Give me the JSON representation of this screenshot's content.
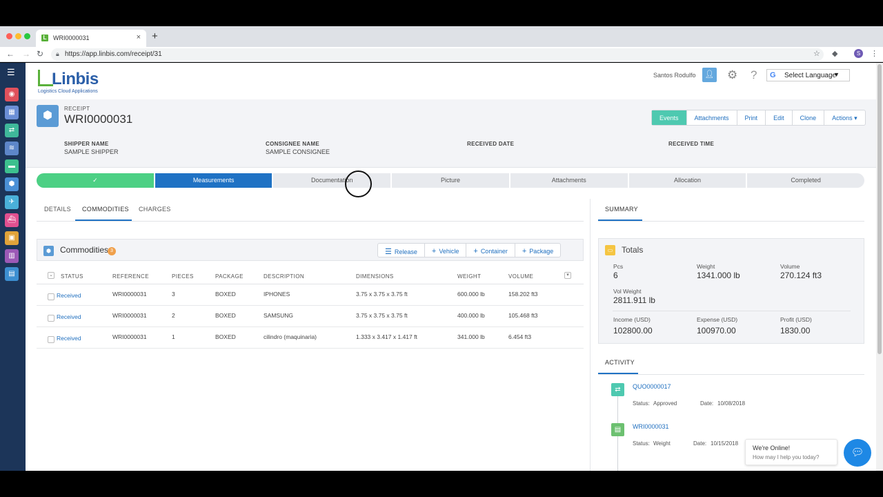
{
  "browser": {
    "tab_title": "WRI0000031",
    "tab_favicon": "L",
    "new_tab": "+",
    "tab_close": "×",
    "url": "https://app.linbis.com/receipt/31",
    "profile_initial": "S"
  },
  "brand": {
    "name": "Linbis",
    "tagline": "Logistics Cloud Applications",
    "colors": {
      "green": "#5ab13b",
      "blue": "#2a5ea8",
      "accent": "#1f72c4",
      "teal": "#4ec9b0"
    }
  },
  "topbar": {
    "user_name": "Santos Rodulfo",
    "language_label": "Select Language"
  },
  "record": {
    "type_label": "RECEIPT",
    "number": "WRI0000031",
    "actions": [
      {
        "label": "Events",
        "active": true
      },
      {
        "label": "Attachments",
        "active": false
      },
      {
        "label": "Print",
        "active": false
      },
      {
        "label": "Edit",
        "active": false
      },
      {
        "label": "Clone",
        "active": false
      },
      {
        "label": "Actions ▾",
        "active": false
      }
    ],
    "fields": [
      {
        "label": "SHIPPER NAME",
        "value": "SAMPLE SHIPPER"
      },
      {
        "label": "CONSIGNEE NAME",
        "value": "SAMPLE CONSIGNEE"
      },
      {
        "label": "RECEIVED DATE",
        "value": ""
      },
      {
        "label": "RECEIVED TIME",
        "value": ""
      }
    ]
  },
  "progress": {
    "steps": [
      {
        "label": "✓",
        "state": "done"
      },
      {
        "label": "Measurements",
        "state": "current"
      },
      {
        "label": "Documentation",
        "state": "pending"
      },
      {
        "label": "Picture",
        "state": "pending"
      },
      {
        "label": "Attachments",
        "state": "pending"
      },
      {
        "label": "Allocation",
        "state": "pending"
      },
      {
        "label": "Completed",
        "state": "pending"
      }
    ]
  },
  "tabs": [
    "DETAILS",
    "COMMODITIES",
    "CHARGES"
  ],
  "commodities": {
    "title": "Commodities",
    "count": "3",
    "buttons": [
      {
        "label": "Release",
        "icon": "list-icon"
      },
      {
        "label": "Vehicle",
        "icon": "plus-icon"
      },
      {
        "label": "Container",
        "icon": "plus-icon"
      },
      {
        "label": "Package",
        "icon": "plus-icon"
      }
    ],
    "columns": [
      "STATUS",
      "REFERENCE",
      "PIECES",
      "PACKAGE",
      "DESCRIPTION",
      "DIMENSIONS",
      "WEIGHT",
      "VOLUME"
    ],
    "rows": [
      {
        "status": "Received",
        "reference": "WRI0000031",
        "pieces": "3",
        "package": "BOXED",
        "description": "IPHONES",
        "dimensions": "3.75 x 3.75 x 3.75 ft",
        "weight": "600.000 lb",
        "volume": "158.202 ft3"
      },
      {
        "status": "Received",
        "reference": "WRI0000031",
        "pieces": "2",
        "package": "BOXED",
        "description": "SAMSUNG",
        "dimensions": "3.75 x 3.75 x 3.75 ft",
        "weight": "400.000 lb",
        "volume": "105.468 ft3"
      },
      {
        "status": "Received",
        "reference": "WRI0000031",
        "pieces": "1",
        "package": "BOXED",
        "description": "cilindro (maquinaria)",
        "dimensions": "1.333 x 3.417 x 1.417 ft",
        "weight": "341.000 lb",
        "volume": "6.454 ft3"
      }
    ]
  },
  "summary": {
    "tab": "SUMMARY",
    "totals_title": "Totals",
    "items": [
      {
        "label": "Pcs",
        "value": "6"
      },
      {
        "label": "Weight",
        "value": "1341.000 lb"
      },
      {
        "label": "Volume",
        "value": "270.124 ft3"
      },
      {
        "label": "Vol Weight",
        "value": "2811.911 lb"
      },
      {
        "label": "Income (USD)",
        "value": "102800.00"
      },
      {
        "label": "Expense (USD)",
        "value": "100970.00"
      },
      {
        "label": "Profit (USD)",
        "value": "1830.00"
      }
    ]
  },
  "activity": {
    "tab": "ACTIVITY",
    "items": [
      {
        "ref": "QUO0000017",
        "status_label": "Status:",
        "status": "Approved",
        "date_label": "Date:",
        "date": "10/08/2018",
        "color": "#4ec9b0"
      },
      {
        "ref": "WRI0000031",
        "status_label": "Status:",
        "status": "Weight",
        "date_label": "Date:",
        "date": "10/15/2018",
        "color": "#6cc070"
      }
    ]
  },
  "chat": {
    "line1": "We're Online!",
    "line2": "How may I help you today?"
  }
}
